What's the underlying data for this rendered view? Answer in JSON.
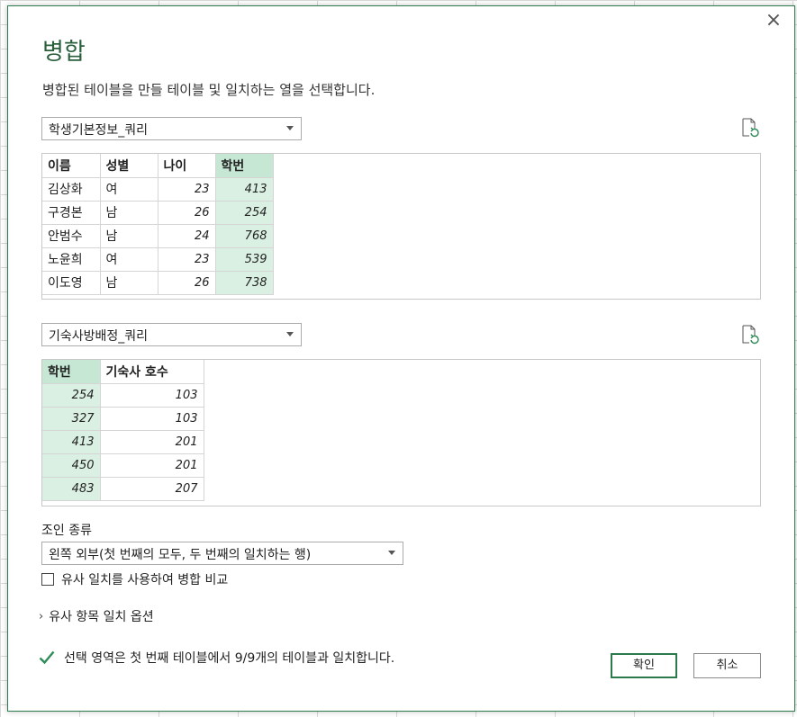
{
  "dialog": {
    "title": "병합",
    "description": "병합된 테이블을 만들 테이블 및 일치하는 열을 선택합니다.",
    "close_label": "×"
  },
  "table1": {
    "dropdown_value": "학생기본정보_쿼리",
    "columns": [
      "이름",
      "성별",
      "나이",
      "학번"
    ],
    "selected_column": "학번",
    "rows": [
      [
        "김상화",
        "여",
        "23",
        "413"
      ],
      [
        "구경본",
        "남",
        "26",
        "254"
      ],
      [
        "안범수",
        "남",
        "24",
        "768"
      ],
      [
        "노윤희",
        "여",
        "23",
        "539"
      ],
      [
        "이도영",
        "남",
        "26",
        "738"
      ]
    ]
  },
  "table2": {
    "dropdown_value": "기숙사방배정_쿼리",
    "columns": [
      "학번",
      "기숙사 호수"
    ],
    "selected_column": "학번",
    "rows": [
      [
        "254",
        "103"
      ],
      [
        "327",
        "103"
      ],
      [
        "413",
        "201"
      ],
      [
        "450",
        "201"
      ],
      [
        "483",
        "207"
      ]
    ]
  },
  "join": {
    "label": "조인 종류",
    "selected": "왼쪽 외부(첫 번째의 모두, 두 번째의 일치하는 행)"
  },
  "fuzzy": {
    "checkbox_label": "유사 일치를 사용하여 병합 비교",
    "checked": false,
    "options_label": "유사 항목 일치 옵션"
  },
  "status": {
    "text": "선택 영역은 첫 번째 테이블에서 9/9개의 테이블과 일치합니다."
  },
  "buttons": {
    "ok": "확인",
    "cancel": "취소"
  },
  "colors": {
    "accent": "#2a5f3c",
    "selected_header": "#c5e7d4",
    "selected_cell": "#daf0e3",
    "check": "#2e8b57"
  }
}
